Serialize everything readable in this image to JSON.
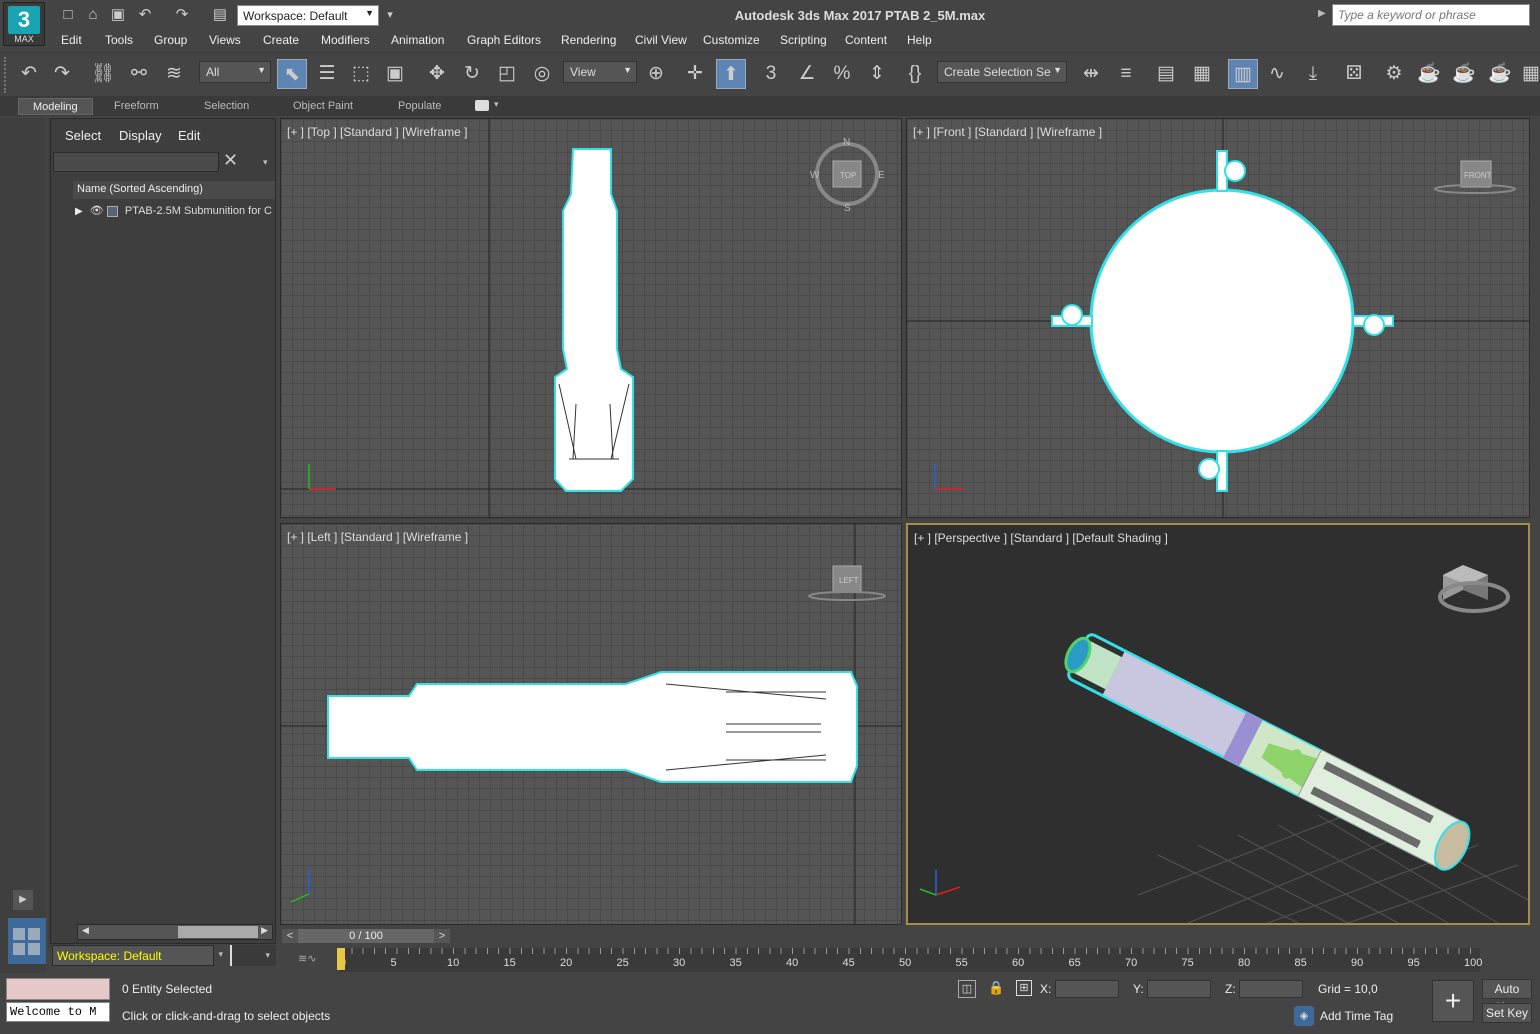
{
  "app": {
    "logo_number": "3",
    "logo_text": "MAX",
    "title": "Autodesk 3ds Max 2017      PTAB 2_5M.max"
  },
  "quick_access": {
    "workspace": "Workspace: Default"
  },
  "search": {
    "placeholder": "Type a keyword or phrase"
  },
  "menu": [
    "Edit",
    "Tools",
    "Group",
    "Views",
    "Create",
    "Modifiers",
    "Animation",
    "Graph Editors",
    "Rendering",
    "Civil View",
    "Customize",
    "Scripting",
    "Content",
    "Help"
  ],
  "toolbar": {
    "filter": "All",
    "ref_coord": "View",
    "selection_set": "Create Selection Se"
  },
  "ribbon": {
    "tabs": [
      "Modeling",
      "Freeform",
      "Selection",
      "Object Paint",
      "Populate"
    ]
  },
  "explorer": {
    "tabs": [
      "Select",
      "Display",
      "Edit"
    ],
    "column_header": "Name (Sorted Ascending)",
    "rows": [
      {
        "name": "PTAB-2.5M Submunition for C"
      }
    ],
    "workspace_label": "Workspace: Default"
  },
  "viewports": {
    "top": {
      "label": "[+ ] [Top ] [Standard ] [Wireframe ]",
      "cube": "TOP",
      "compass": [
        "N",
        "E",
        "S",
        "W"
      ]
    },
    "front": {
      "label": "[+ ] [Front ] [Standard ] [Wireframe ]",
      "cube": "FRONT"
    },
    "left": {
      "label": "[+ ] [Left ] [Standard ] [Wireframe ]",
      "cube": "LEFT"
    },
    "perspective": {
      "label": "[+ ] [Perspective ] [Standard ] [Default Shading ]"
    }
  },
  "timeline": {
    "frame": "0 / 100",
    "prev": "<",
    "next": ">",
    "ticks": [
      "0",
      "5",
      "10",
      "15",
      "20",
      "25",
      "30",
      "35",
      "40",
      "45",
      "50",
      "55",
      "60",
      "65",
      "70",
      "75",
      "80",
      "85",
      "90",
      "95",
      "100"
    ]
  },
  "status": {
    "welcome": "Welcome to M",
    "selected": "0 Entity Selected",
    "prompt": "Click or click-and-drag to select objects",
    "x_label": "X:",
    "y_label": "Y:",
    "z_label": "Z:",
    "grid": "Grid = 10,0",
    "add_time_tag": "Add Time Tag",
    "auto_key": "Auto Key",
    "set_key": "Set Key"
  },
  "colors": {
    "accent": "#1aa3b3",
    "selection": "#33e0e6",
    "active_viewport_border": "#a88b4a",
    "button_active": "#5e84b3"
  }
}
